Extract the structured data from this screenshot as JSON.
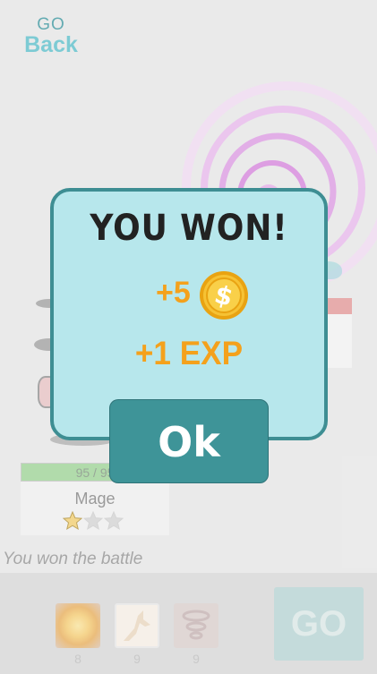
{
  "back_button": {
    "top_label": "GO",
    "label": "Back"
  },
  "player": {
    "hp_text": "95 / 95",
    "hp_fraction": 1.0,
    "class_name": "Mage",
    "stars_total": 3,
    "stars_filled": 1
  },
  "battle_log": "You won the battle",
  "abilities": [
    {
      "icon": "sun-orb-icon",
      "count": "8"
    },
    {
      "icon": "unicorn-icon",
      "count": "9"
    },
    {
      "icon": "whirlwind-icon",
      "count": "9"
    }
  ],
  "go_button": {
    "label": "GO"
  },
  "dialog": {
    "title": "YOU WON!",
    "coins_reward": "+5",
    "coin_icon": "gold-coin-icon",
    "exp_reward": "+1 EXP",
    "ok_label": "Ok"
  },
  "colors": {
    "dialog_bg": "#b7e7ec",
    "dialog_border": "#3e8e93",
    "reward_orange": "#f4a11c",
    "ok_button": "#3e9498",
    "back_text": "#6cc4cf"
  }
}
